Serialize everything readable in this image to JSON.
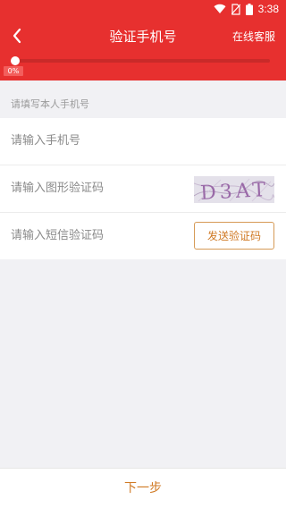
{
  "status_bar": {
    "time": "3:38",
    "icons": [
      "wifi-icon",
      "no-sim-icon",
      "battery-icon"
    ]
  },
  "header": {
    "title": "验证手机号",
    "back_icon": "chevron-left-icon",
    "online_service": "在线客服"
  },
  "progress": {
    "percent_label": "0%",
    "value": 0
  },
  "form": {
    "section_hint": "请填写本人手机号",
    "phone_placeholder": "请输入手机号",
    "captcha_placeholder": "请输入图形验证码",
    "captcha_text": "D3AT",
    "sms_placeholder": "请输入短信验证码",
    "send_sms_label": "发送验证码"
  },
  "footer": {
    "next_label": "下一步"
  },
  "colors": {
    "header_bg": "#e7302f",
    "accent": "#d07a25",
    "page_bg": "#f1f1f4"
  }
}
